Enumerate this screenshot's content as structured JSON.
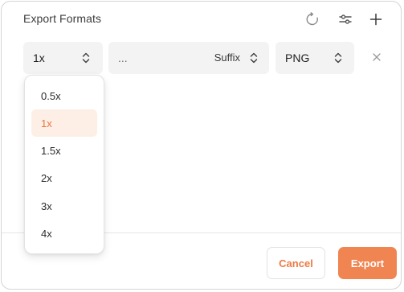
{
  "dialog": {
    "title": "Export Formats"
  },
  "toolbar": {
    "icons": [
      "refresh-icon",
      "sliders-icon",
      "plus-icon"
    ]
  },
  "row": {
    "scale": "1x",
    "suffix_placeholder": "...",
    "suffix_label": "Suffix",
    "format": "PNG"
  },
  "dropdown": {
    "options": [
      "0.5x",
      "1x",
      "1.5x",
      "2x",
      "3x",
      "4x"
    ],
    "selected": "1x"
  },
  "footer": {
    "cancel_label": "Cancel",
    "export_label": "Export"
  },
  "colors": {
    "accent": "#f08552",
    "accent_text": "#ee7a45",
    "selected_bg": "#fdeee6",
    "field_bg": "#f3f3f3"
  }
}
